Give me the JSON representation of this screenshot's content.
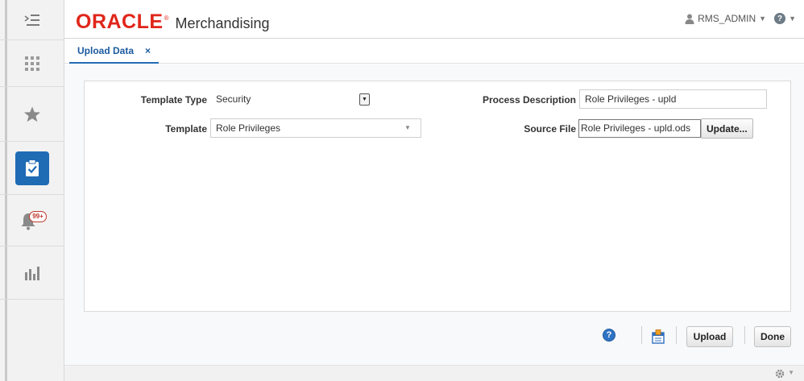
{
  "header": {
    "brand": "ORACLE",
    "brand_mark": "®",
    "app_name": "Merchandising",
    "user": "RMS_ADMIN",
    "help_symbol": "?"
  },
  "rail": {
    "items": [
      {
        "icon": "menu-icon"
      },
      {
        "icon": "apps-grid-icon"
      },
      {
        "icon": "favorites-star-icon"
      },
      {
        "icon": "tasks-clipboard-icon",
        "active": true
      },
      {
        "icon": "notifications-bell-icon",
        "badge": "99+"
      },
      {
        "icon": "reports-chart-icon"
      }
    ]
  },
  "tabs": [
    {
      "label": "Upload Data",
      "close": "×"
    }
  ],
  "form": {
    "template_type": {
      "label": "Template Type",
      "value": "Security"
    },
    "template": {
      "label": "Template",
      "value": "Role Privileges"
    },
    "process_description": {
      "label": "Process Description",
      "value": "Role Privileges - upld"
    },
    "source_file": {
      "label": "Source File",
      "value": "Role Privileges - upld.ods",
      "button": "Update..."
    }
  },
  "actions": {
    "help_symbol": "?",
    "upload": "Upload",
    "done": "Done"
  },
  "colors": {
    "brand_red": "#e0261a",
    "accent_blue": "#1f6bb4",
    "badge_red": "#c0392b"
  }
}
